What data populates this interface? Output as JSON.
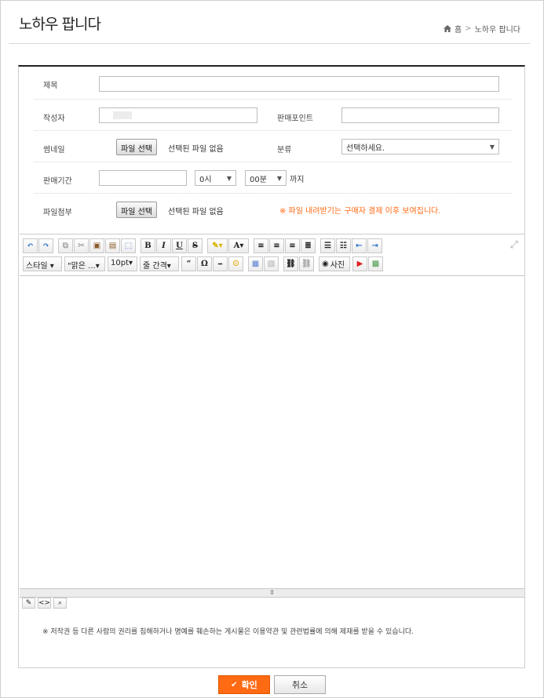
{
  "header": {
    "title": "노하우 팝니다",
    "breadcrumb": {
      "home": "홈",
      "current": "노하우 팝니다"
    }
  },
  "form": {
    "title_label": "제목",
    "title_value": "",
    "author_label": "작성자",
    "author_value": "",
    "selling_point_label": "판매포인트",
    "selling_point_value": "",
    "thumbnail_label": "썸네일",
    "file_button": "파일 선택",
    "no_file": "선택된 파일 없음",
    "category_label": "분류",
    "category_selected": "선택하세요.",
    "period_label": "판매기간",
    "period_date_value": "",
    "hour_selected": "0시",
    "minute_selected": "00분",
    "until": "까지",
    "attach_label": "파일첨부",
    "attach_notice": "※ 파일 내려받기는 구매자 결제 이후 보여집니다."
  },
  "editor": {
    "style_dd": "스타일",
    "font_dd": "\"맑은 ...",
    "size_dd": "10pt",
    "line_dd": "줄 간격",
    "photo_label": "사진",
    "quote_glyph": "“",
    "omega_glyph": "Ω"
  },
  "footer_note": "※ 저작권 등 다른 사람의 권리를 침해하거나 명예를 훼손하는 게시물은 이용약관 및 관련법률에 의해 제재를 받을 수 있습니다.",
  "buttons": {
    "confirm": "확인",
    "cancel": "취소"
  },
  "colors": {
    "accent": "#ff6a13",
    "notice": "#ff6a13"
  }
}
